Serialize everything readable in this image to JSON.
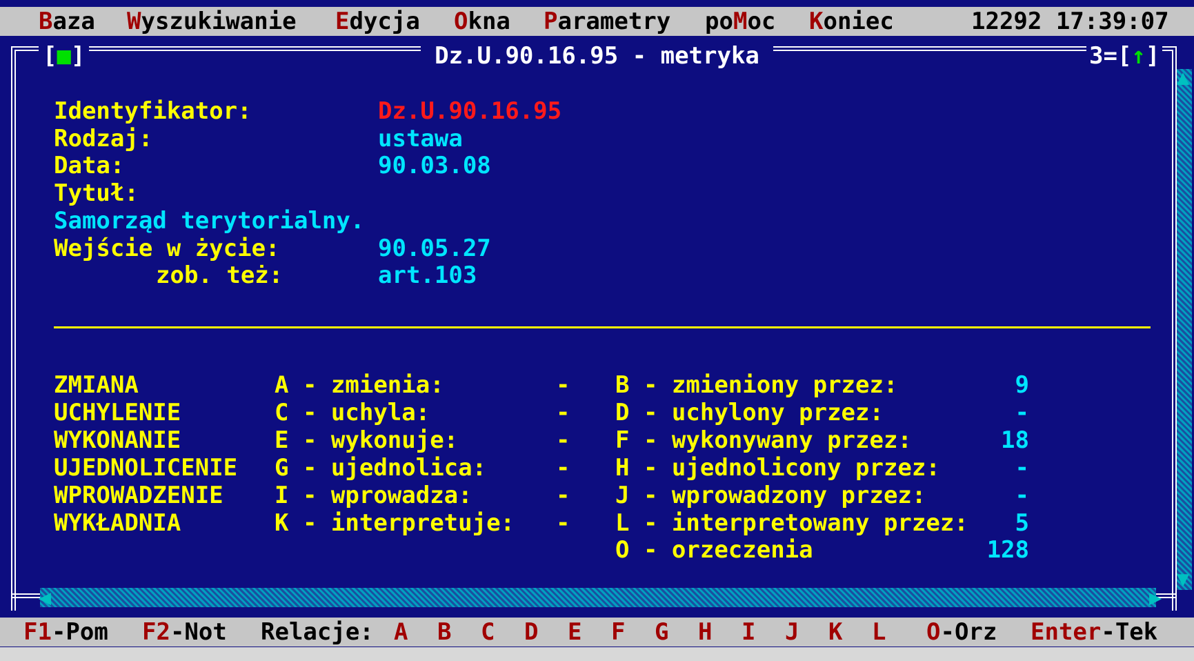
{
  "menu": {
    "items": [
      {
        "hot": "B",
        "rest": "aza"
      },
      {
        "hot": "W",
        "rest": "yszukiwanie"
      },
      {
        "hot": "E",
        "rest": "dycja"
      },
      {
        "hot": "O",
        "rest": "kna"
      },
      {
        "hot": "P",
        "rest": "arametry"
      },
      {
        "pre": "po",
        "hot": "M",
        "rest": "oc"
      },
      {
        "hot": "K",
        "rest": "oniec"
      }
    ],
    "clock": "12292 17:39:07"
  },
  "window": {
    "title": "Dz.U.90.16.95 - metryka",
    "close_box": "[■]",
    "number": "3=[↑]"
  },
  "metadata": {
    "identyfikator_label": "Identyfikator:",
    "identyfikator_value": "Dz.U.90.16.95",
    "rodzaj_label": "Rodzaj:",
    "rodzaj_value": "ustawa",
    "data_label": "Data:",
    "data_value": "90.03.08",
    "tytul_label": "Tytuł:",
    "tytul_value": "Samorząd terytorialny.",
    "wejscie_label": "Wejście w życie:",
    "wejscie_value": "90.05.27",
    "zob_label": "zob. też:",
    "zob_value": "art.103"
  },
  "relations": [
    {
      "category": "ZMIANA",
      "left_key": "A",
      "left_text": "zmienia:",
      "left_value": "-",
      "right_key": "B",
      "right_text": "zmieniony przez:",
      "right_value": "9"
    },
    {
      "category": "UCHYLENIE",
      "left_key": "C",
      "left_text": "uchyla:",
      "left_value": "-",
      "right_key": "D",
      "right_text": "uchylony przez:",
      "right_value": "-"
    },
    {
      "category": "WYKONANIE",
      "left_key": "E",
      "left_text": "wykonuje:",
      "left_value": "-",
      "right_key": "F",
      "right_text": "wykonywany przez:",
      "right_value": "18"
    },
    {
      "category": "UJEDNOLICENIE",
      "left_key": "G",
      "left_text": "ujednolica:",
      "left_value": "-",
      "right_key": "H",
      "right_text": "ujednolicony przez:",
      "right_value": "-"
    },
    {
      "category": "WPROWADZENIE",
      "left_key": "I",
      "left_text": "wprowadza:",
      "left_value": "-",
      "right_key": "J",
      "right_text": "wprowadzony przez:",
      "right_value": "-"
    },
    {
      "category": "WYKŁADNIA",
      "left_key": "K",
      "left_text": "interpretuje:",
      "left_value": "-",
      "right_key": "L",
      "right_text": "interpretowany przez:",
      "right_value": "5"
    }
  ],
  "orzeczenia": {
    "key": "O",
    "text": "orzeczenia",
    "value": "128"
  },
  "statusbar": {
    "f1_key": "F1",
    "f1_text": "-Pom",
    "f2_key": "F2",
    "f2_text": "-Not",
    "relacje_label": "Relacje:",
    "relacje_keys": [
      "A",
      "B",
      "C",
      "D",
      "E",
      "F",
      "G",
      "H",
      "I",
      "J",
      "K",
      "L"
    ],
    "orz_key": "O",
    "orz_text": "-Orz",
    "enter_key": "Enter",
    "enter_text": "-Tek"
  }
}
